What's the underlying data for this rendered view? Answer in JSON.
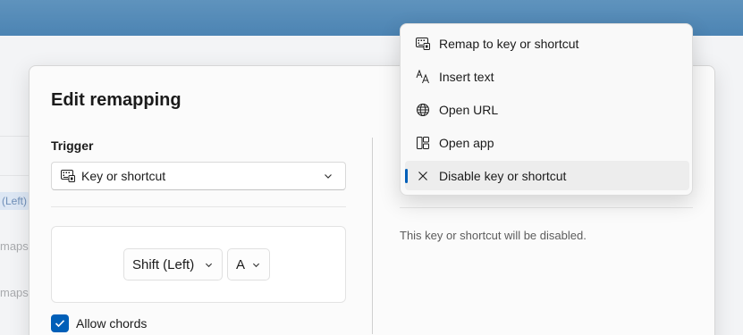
{
  "background": {
    "partial_key_label": "(Left)",
    "row_text_1": "maps",
    "row_text_2": "maps"
  },
  "dialog": {
    "title": "Edit remapping",
    "trigger": {
      "section_label": "Trigger",
      "type_value": "Key or shortcut",
      "keys": [
        "Shift (Left)",
        "A"
      ]
    },
    "allow_chords": {
      "label": "Allow chords",
      "checked": true
    },
    "action_description": "This key or shortcut will be disabled."
  },
  "action_menu": {
    "items": [
      {
        "label": "Remap to key or shortcut",
        "icon": "keyboard-icon",
        "selected": false
      },
      {
        "label": "Insert text",
        "icon": "text-icon",
        "selected": false
      },
      {
        "label": "Open URL",
        "icon": "globe-icon",
        "selected": false
      },
      {
        "label": "Open app",
        "icon": "app-icon",
        "selected": false
      },
      {
        "label": "Disable key or shortcut",
        "icon": "close-icon",
        "selected": true
      }
    ]
  },
  "colors": {
    "accent": "#005fb8",
    "titlebar": "#5f93bd"
  }
}
